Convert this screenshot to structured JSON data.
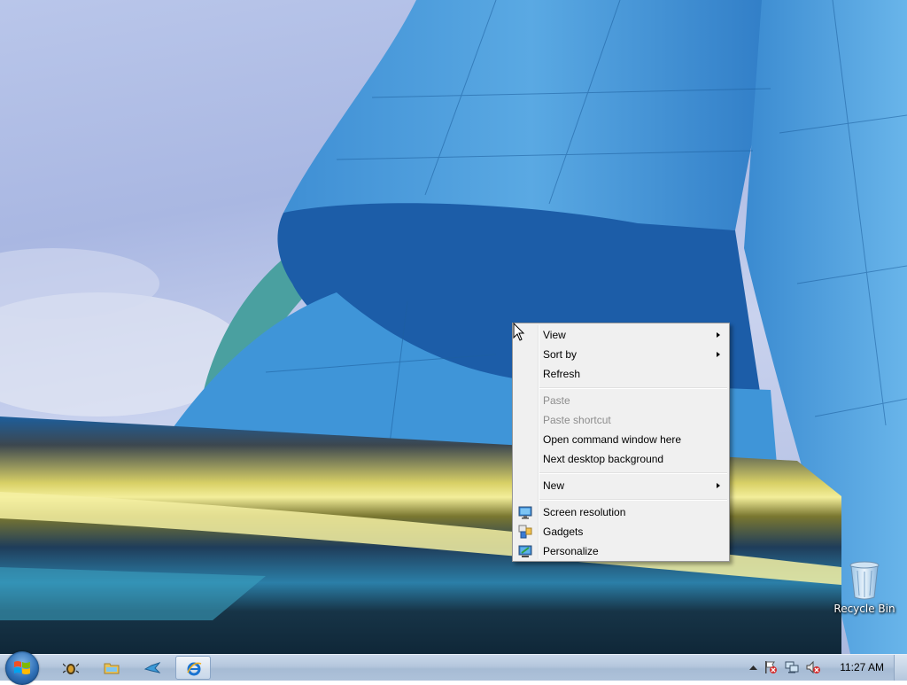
{
  "desktop": {
    "icons": [
      {
        "label": "Recycle Bin",
        "icon": "recycle-bin-icon"
      }
    ]
  },
  "context_menu": {
    "items": [
      {
        "label": "View",
        "enabled": true,
        "submenu": true
      },
      {
        "label": "Sort by",
        "enabled": true,
        "submenu": true
      },
      {
        "label": "Refresh",
        "enabled": true
      },
      {
        "label": "Paste",
        "enabled": false
      },
      {
        "label": "Paste shortcut",
        "enabled": false
      },
      {
        "label": "Open command window here",
        "enabled": true
      },
      {
        "label": "Next desktop background",
        "enabled": true
      },
      {
        "label": "New",
        "enabled": true,
        "submenu": true
      },
      {
        "label": "Screen resolution",
        "enabled": true,
        "icon": "monitor-icon"
      },
      {
        "label": "Gadgets",
        "enabled": true,
        "icon": "gadgets-icon"
      },
      {
        "label": "Personalize",
        "enabled": true,
        "icon": "personalize-icon"
      }
    ]
  },
  "taskbar": {
    "start_icon": "windows-logo-icon",
    "pinned": [
      {
        "icon": "bug-icon"
      },
      {
        "icon": "folder-icon"
      },
      {
        "icon": "bird-icon"
      },
      {
        "icon": "internet-explorer-icon",
        "active": true
      }
    ],
    "tray": {
      "icons": [
        "show-hidden-icons-chevron",
        "action-center-flag-icon",
        "network-icon",
        "volume-muted-icon"
      ],
      "clock": "11:27 AM"
    }
  },
  "colors": {
    "menu_background": "#f0f0f0",
    "menu_border": "#979797",
    "disabled_text": "#8d8d8d",
    "taskbar": "#b4c6dc"
  }
}
